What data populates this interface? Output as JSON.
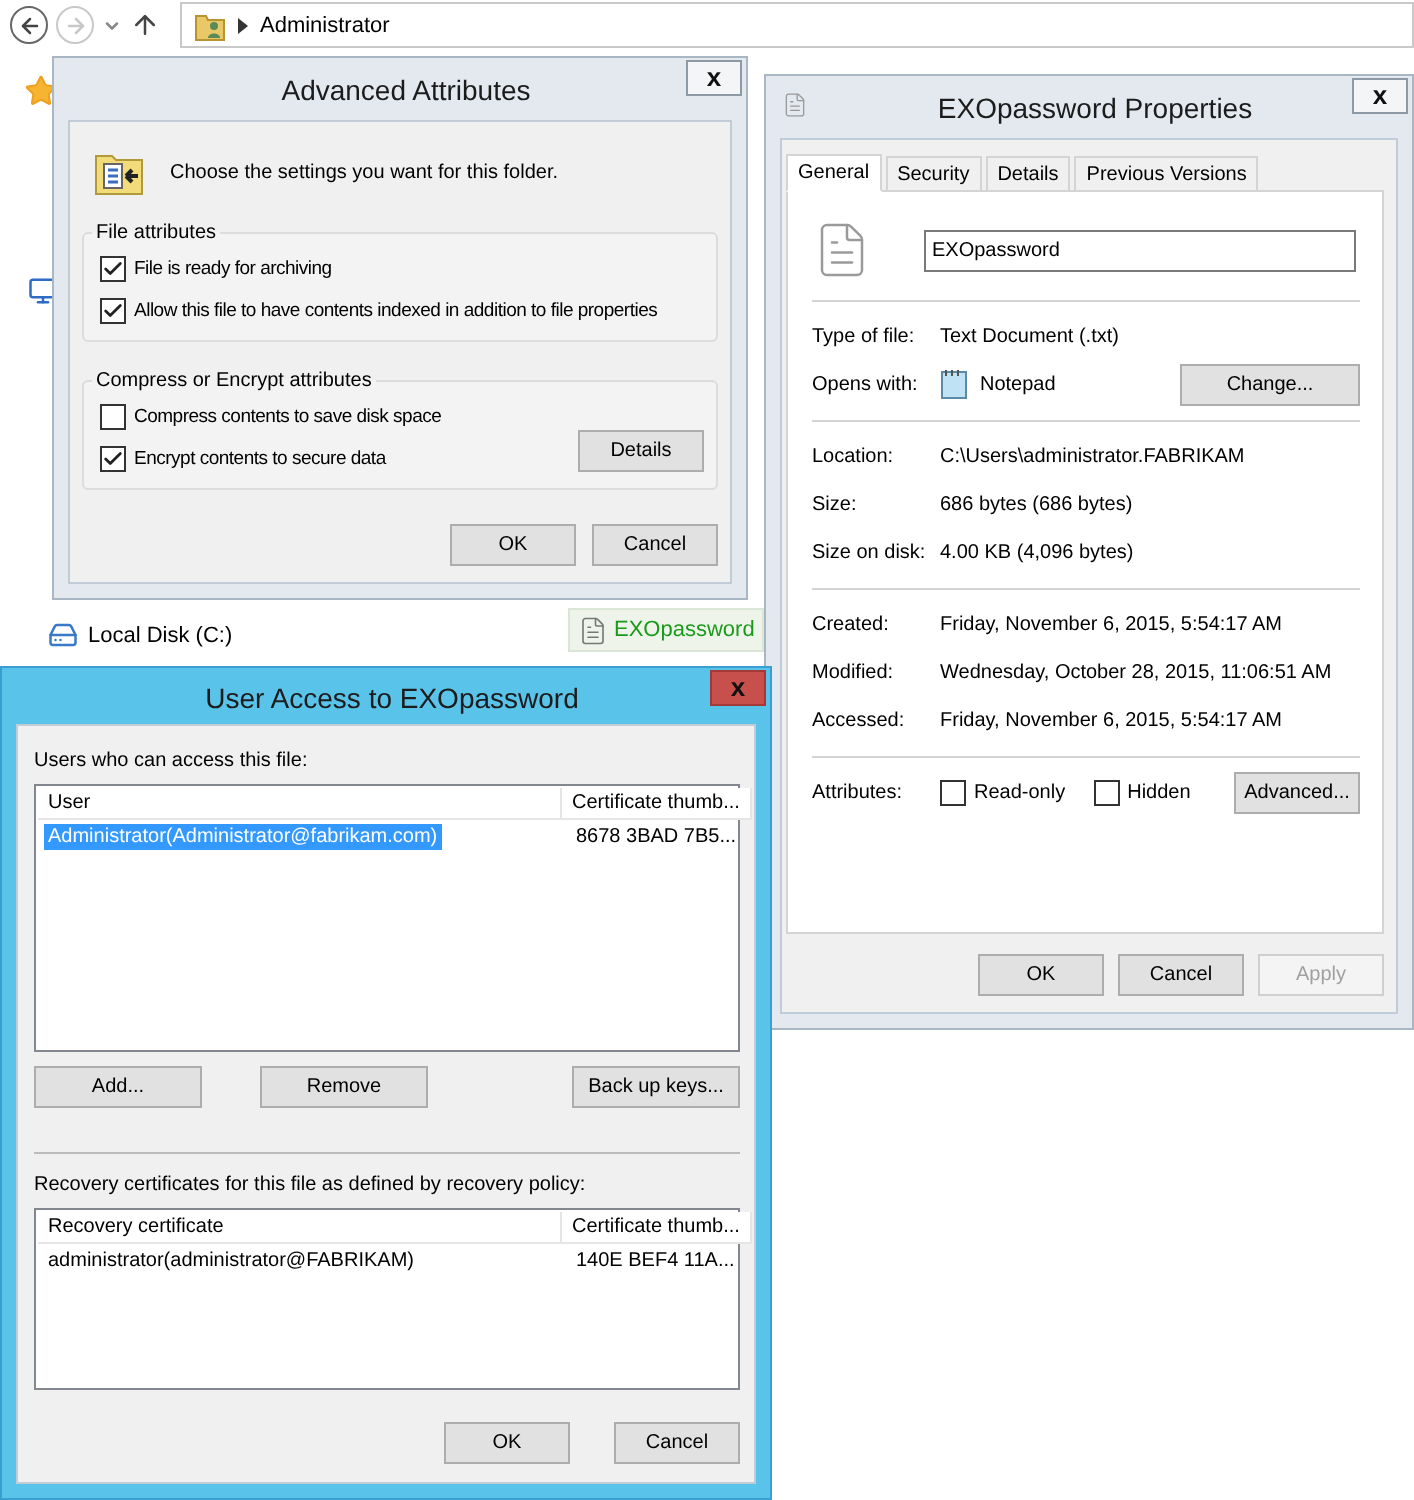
{
  "explorer": {
    "address": "Administrator",
    "nav_items": [
      {
        "label": "Local Disk (C:)"
      }
    ],
    "file": {
      "label": "EXOpassword",
      "encrypted": true
    }
  },
  "advanced_attributes": {
    "title": "Advanced Attributes",
    "active": false,
    "close": "x",
    "intro": "Choose the settings you want for this folder.",
    "groups": [
      {
        "title": "File attributes",
        "options": [
          {
            "label": "File is ready for archiving",
            "checked": true
          },
          {
            "label": "Allow this file to have contents indexed in addition to file properties",
            "checked": true
          }
        ]
      },
      {
        "title": "Compress or Encrypt attributes",
        "options": [
          {
            "label": "Compress contents to save disk space",
            "checked": false
          },
          {
            "label": "Encrypt contents to secure data",
            "checked": true
          }
        ],
        "button": "Details"
      }
    ],
    "buttons": [
      "OK",
      "Cancel"
    ]
  },
  "properties": {
    "title": "EXOpassword Properties",
    "active": false,
    "close": "x",
    "tabs": [
      {
        "label": "General",
        "selected": true
      },
      {
        "label": "Security",
        "selected": false
      },
      {
        "label": "Details",
        "selected": false
      },
      {
        "label": "Previous Versions",
        "selected": false
      }
    ],
    "file_name": "EXOpassword",
    "sections": [
      [
        {
          "kind": "text",
          "label": "Type of file:",
          "value": "Text Document (.txt)"
        },
        {
          "kind": "app",
          "label": "Opens with:",
          "value": "Notepad",
          "button": "Change..."
        }
      ],
      [
        {
          "kind": "text",
          "label": "Location:",
          "value": "C:\\Users\\administrator.FABRIKAM"
        },
        {
          "kind": "text",
          "label": "Size:",
          "value": "686 bytes (686 bytes)"
        },
        {
          "kind": "text",
          "label": "Size on disk:",
          "value": "4.00 KB (4,096 bytes)"
        }
      ],
      [
        {
          "kind": "text",
          "label": "Created:",
          "value": "Friday, November 6, 2015, 5:54:17 AM"
        },
        {
          "kind": "text",
          "label": "Modified:",
          "value": "Wednesday, October 28, 2015, 11:06:51 AM"
        },
        {
          "kind": "text",
          "label": "Accessed:",
          "value": "Friday, November 6, 2015, 5:54:17 AM"
        }
      ]
    ],
    "attributes": {
      "label": "Attributes:",
      "options": [
        {
          "label": "Read-only",
          "checked": false
        },
        {
          "label": "Hidden",
          "checked": false
        }
      ],
      "button": "Advanced..."
    },
    "buttons": [
      {
        "label": "OK",
        "disabled": false
      },
      {
        "label": "Cancel",
        "disabled": false
      },
      {
        "label": "Apply",
        "disabled": true
      }
    ]
  },
  "user_access": {
    "title": "User Access to EXOpassword",
    "active": true,
    "close": "x",
    "users_label": "Users who can access this file:",
    "users": {
      "columns": [
        "User",
        "Certificate thumb..."
      ],
      "rows": [
        {
          "cells": [
            "Administrator(Administrator@fabrikam.com)",
            "8678 3BAD 7B5..."
          ],
          "selected": true
        }
      ]
    },
    "user_buttons": [
      "Add...",
      "Remove",
      "Back up keys..."
    ],
    "recovery_label": "Recovery certificates for this file as defined by recovery policy:",
    "recovery": {
      "columns": [
        "Recovery certificate",
        "Certificate thumb..."
      ],
      "rows": [
        {
          "cells": [
            "administrator(administrator@FABRIKAM)",
            "140E BEF4 11A..."
          ],
          "selected": false
        }
      ]
    },
    "buttons": [
      "OK",
      "Cancel"
    ]
  }
}
